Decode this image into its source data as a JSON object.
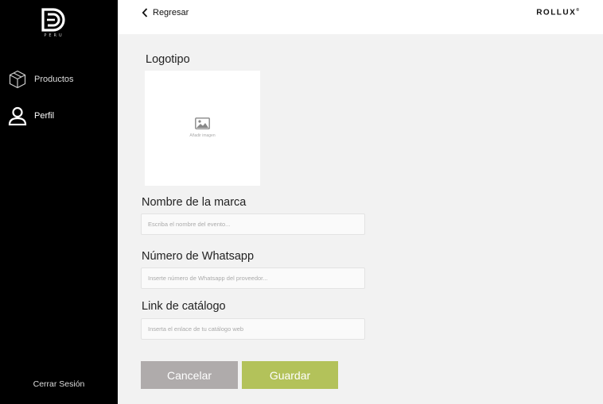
{
  "sidebar": {
    "logo_sub": "PERU",
    "items": [
      {
        "label": "Productos",
        "icon": "box-icon"
      },
      {
        "label": "Perfil",
        "icon": "user-icon"
      }
    ],
    "logout_label": "Cerrar Sesión"
  },
  "header": {
    "back_label": "Regresar",
    "brand": "ROLLUX"
  },
  "form": {
    "logo_label": "Logotipo",
    "add_image_text": "Añadir imagen",
    "brand_name_label": "Nombre de la marca",
    "brand_name_placeholder": "Escriba el nombre del evento...",
    "whatsapp_label": "Número de Whatsapp",
    "whatsapp_placeholder": "Inserte número de Whatsapp del proveedor...",
    "catalog_label": "Link de catálogo",
    "catalog_placeholder": "Inserta el enlace de tu catálogo web",
    "cancel_label": "Cancelar",
    "save_label": "Guardar"
  },
  "colors": {
    "sidebar_bg": "#000000",
    "page_bg": "#f2f2f2",
    "cancel_button": "#afabab",
    "save_button": "#b3c25a"
  }
}
